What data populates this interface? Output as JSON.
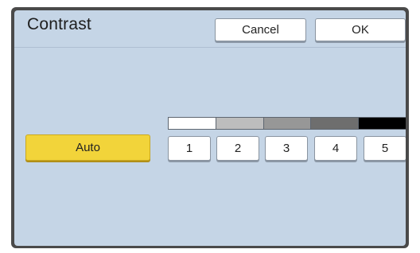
{
  "dialog": {
    "title": "Contrast",
    "cancel_label": "Cancel",
    "ok_label": "OK",
    "auto_label": "Auto"
  },
  "contrast": {
    "levels": [
      "1",
      "2",
      "3",
      "4",
      "5"
    ],
    "scale_colors": [
      "#ffffff",
      "#bdbdbd",
      "#979797",
      "#6e6e6e",
      "#000000"
    ]
  },
  "colors": {
    "panel": "#c5d5e6",
    "auto_button": "#f2d43a"
  }
}
